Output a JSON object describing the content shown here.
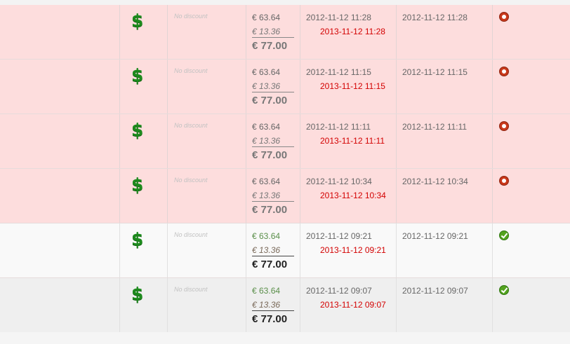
{
  "rows": [
    {
      "status": "unpaid",
      "icon": "dollar-icon",
      "currency_symbol": "$",
      "discount": "No discount",
      "net": "€ 63.64",
      "vat": "€ 13.36",
      "total": "€ 77.00",
      "created": "2012-11-12 11:28",
      "due": "2013-11-12 11:28",
      "paid_date": "2012-11-12 11:28",
      "status_icon": "record-icon"
    },
    {
      "status": "unpaid",
      "icon": "dollar-icon",
      "currency_symbol": "$",
      "discount": "No discount",
      "net": "€ 63.64",
      "vat": "€ 13.36",
      "total": "€ 77.00",
      "created": "2012-11-12 11:15",
      "due": "2013-11-12 11:15",
      "paid_date": "2012-11-12 11:15",
      "status_icon": "record-icon"
    },
    {
      "status": "unpaid",
      "icon": "dollar-icon",
      "currency_symbol": "$",
      "discount": "No discount",
      "net": "€ 63.64",
      "vat": "€ 13.36",
      "total": "€ 77.00",
      "created": "2012-11-12 11:11",
      "due": "2013-11-12 11:11",
      "paid_date": "2012-11-12 11:11",
      "status_icon": "record-icon"
    },
    {
      "status": "unpaid",
      "icon": "dollar-icon",
      "currency_symbol": "$",
      "discount": "No discount",
      "net": "€ 63.64",
      "vat": "€ 13.36",
      "total": "€ 77.00",
      "created": "2012-11-12 10:34",
      "due": "2013-11-12 10:34",
      "paid_date": "2012-11-12 10:34",
      "status_icon": "record-icon"
    },
    {
      "status": "paid",
      "icon": "dollar-icon",
      "currency_symbol": "$",
      "discount": "No discount",
      "net": "€ 63.64",
      "vat": "€ 13.36",
      "total": "€ 77.00",
      "created": "2012-11-12 09:21",
      "due": "2013-11-12 09:21",
      "paid_date": "2012-11-12 09:21",
      "status_icon": "check-icon"
    },
    {
      "status": "paid",
      "icon": "dollar-icon",
      "currency_symbol": "$",
      "discount": "No discount",
      "net": "€ 63.64",
      "vat": "€ 13.36",
      "total": "€ 77.00",
      "created": "2012-11-12 09:07",
      "due": "2013-11-12 09:07",
      "paid_date": "2012-11-12 09:07",
      "status_icon": "check-icon"
    }
  ],
  "colors": {
    "unpaid_row_bg": "#fddddd",
    "paid_row_bg": "#f9f9f9",
    "dollar_green": "#1d8a1d",
    "due_date_red": "#d30000",
    "status_red": "#c8381a",
    "status_green": "#53a31f"
  }
}
